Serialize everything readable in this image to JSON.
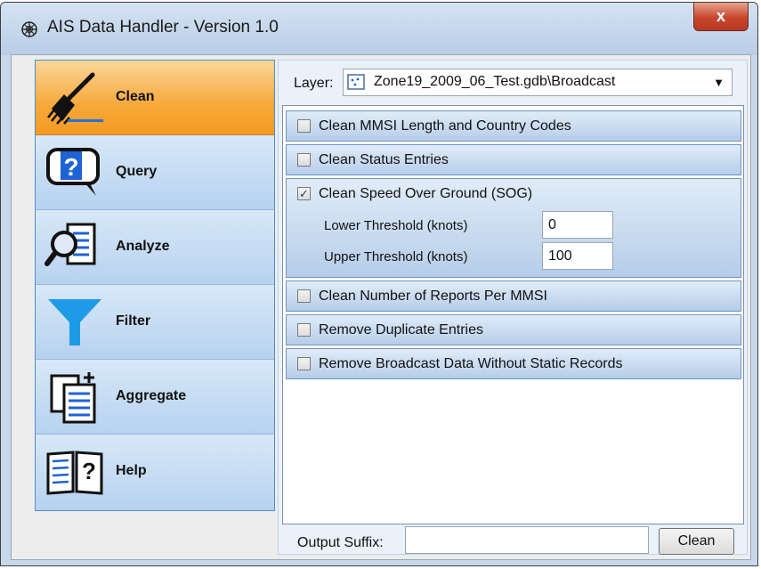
{
  "window": {
    "title": "AIS Data Handler - Version 1.0",
    "close_label": "x"
  },
  "sidebar": {
    "items": [
      {
        "label": "Clean",
        "icon": "broom-icon",
        "active": true
      },
      {
        "label": "Query",
        "icon": "question-bubble-icon",
        "active": false
      },
      {
        "label": "Analyze",
        "icon": "magnify-document-icon",
        "active": false
      },
      {
        "label": "Filter",
        "icon": "funnel-icon",
        "active": false
      },
      {
        "label": "Aggregate",
        "icon": "add-documents-icon",
        "active": false
      },
      {
        "label": "Help",
        "icon": "help-book-icon",
        "active": false
      }
    ]
  },
  "layer": {
    "label": "Layer:",
    "value": "Zone19_2009_06_Test.gdb\\Broadcast",
    "icon": "point-layer-icon"
  },
  "options": [
    {
      "label": "Clean MMSI Length and Country Codes",
      "checked": false
    },
    {
      "label": "Clean Status Entries",
      "checked": false
    },
    {
      "label": "Clean Speed Over Ground (SOG)",
      "checked": true,
      "fields": [
        {
          "label": "Lower Threshold (knots)",
          "value": "0"
        },
        {
          "label": "Upper Threshold (knots)",
          "value": "100"
        }
      ]
    },
    {
      "label": "Clean Number of Reports Per MMSI",
      "checked": false
    },
    {
      "label": "Remove Duplicate Entries",
      "checked": false
    },
    {
      "label": "Remove Broadcast Data Without Static Records",
      "checked": false
    }
  ],
  "footer": {
    "suffix_label": "Output Suffix:",
    "suffix_value": "",
    "button_label": "Clean"
  },
  "colors": {
    "active_tab": "#f6a93a",
    "tab": "#c6ddf4",
    "option_header": "#b5cde9",
    "close_button": "#c7462c"
  }
}
